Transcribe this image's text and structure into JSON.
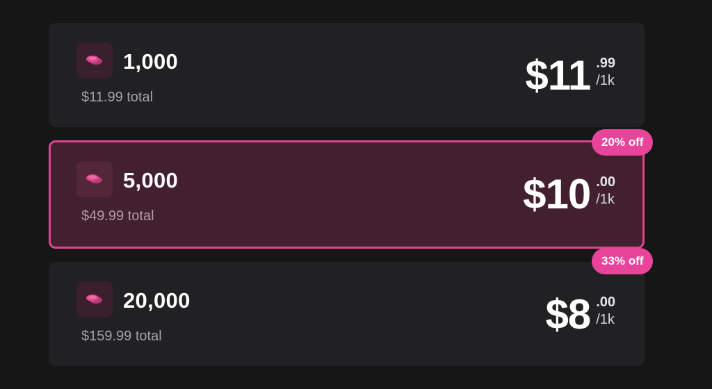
{
  "colors": {
    "background": "#161617",
    "card": "#212123",
    "selected_card": "#43202f",
    "accent": "#e2438f",
    "badge": "#e8449a"
  },
  "plans": [
    {
      "quantity": "1,000",
      "total": "$11.99 total",
      "price_main": "$11",
      "price_cents": ".99",
      "price_unit": "/1k",
      "selected": false,
      "icon": "coins-icon"
    },
    {
      "quantity": "5,000",
      "total": "$49.99 total",
      "price_main": "$10",
      "price_cents": ".00",
      "price_unit": "/1k",
      "selected": true,
      "icon": "coins-icon",
      "badge": "20% off"
    },
    {
      "quantity": "20,000",
      "total": "$159.99 total",
      "price_main": "$8",
      "price_cents": ".00",
      "price_unit": "/1k",
      "selected": false,
      "icon": "coins-icon",
      "badge": "33% off"
    }
  ]
}
